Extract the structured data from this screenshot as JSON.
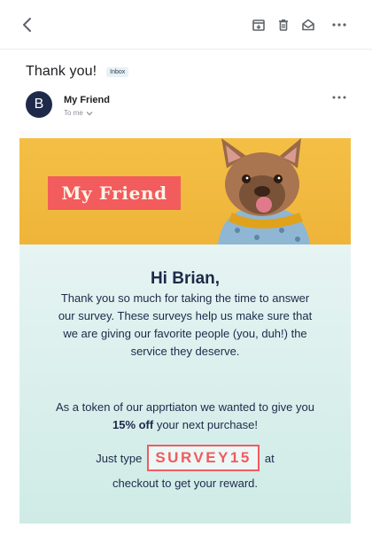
{
  "toolbar": {
    "back_icon": "chevron-left-icon",
    "tools": [
      "archive-icon",
      "trash-icon",
      "mark-unread-icon",
      "more-horizontal-icon"
    ],
    "icon_color": "#5f6368"
  },
  "message": {
    "subject": "Thank you!",
    "label": "Inbox",
    "avatar_initial": "B",
    "sender_name": "My Friend",
    "recipient": "To me",
    "avatar_color": "#1f2a4a"
  },
  "email": {
    "brand_name": "My Friend",
    "greeting": "Hi Brian,",
    "paragraph1": "Thank you so much for taking the time to answer our survey. These surveys help us make sure that we are giving our favorite people (you, duh!) the service they deserve.",
    "paragraph2_before": "As a token of our apprtiaton we wanted to give you ",
    "paragraph2_bold": "15% off",
    "paragraph2_after": " your next purchase!",
    "code_prefix": "Just type",
    "code": "SURVEY15",
    "code_suffix": "at",
    "closing": "checkout to get your reward.",
    "colors": {
      "accent": "#f25c5c",
      "navy": "#1c2a4a",
      "hero_yellow": "#f4bf45",
      "panel_mint": "#e6f4f3"
    }
  }
}
